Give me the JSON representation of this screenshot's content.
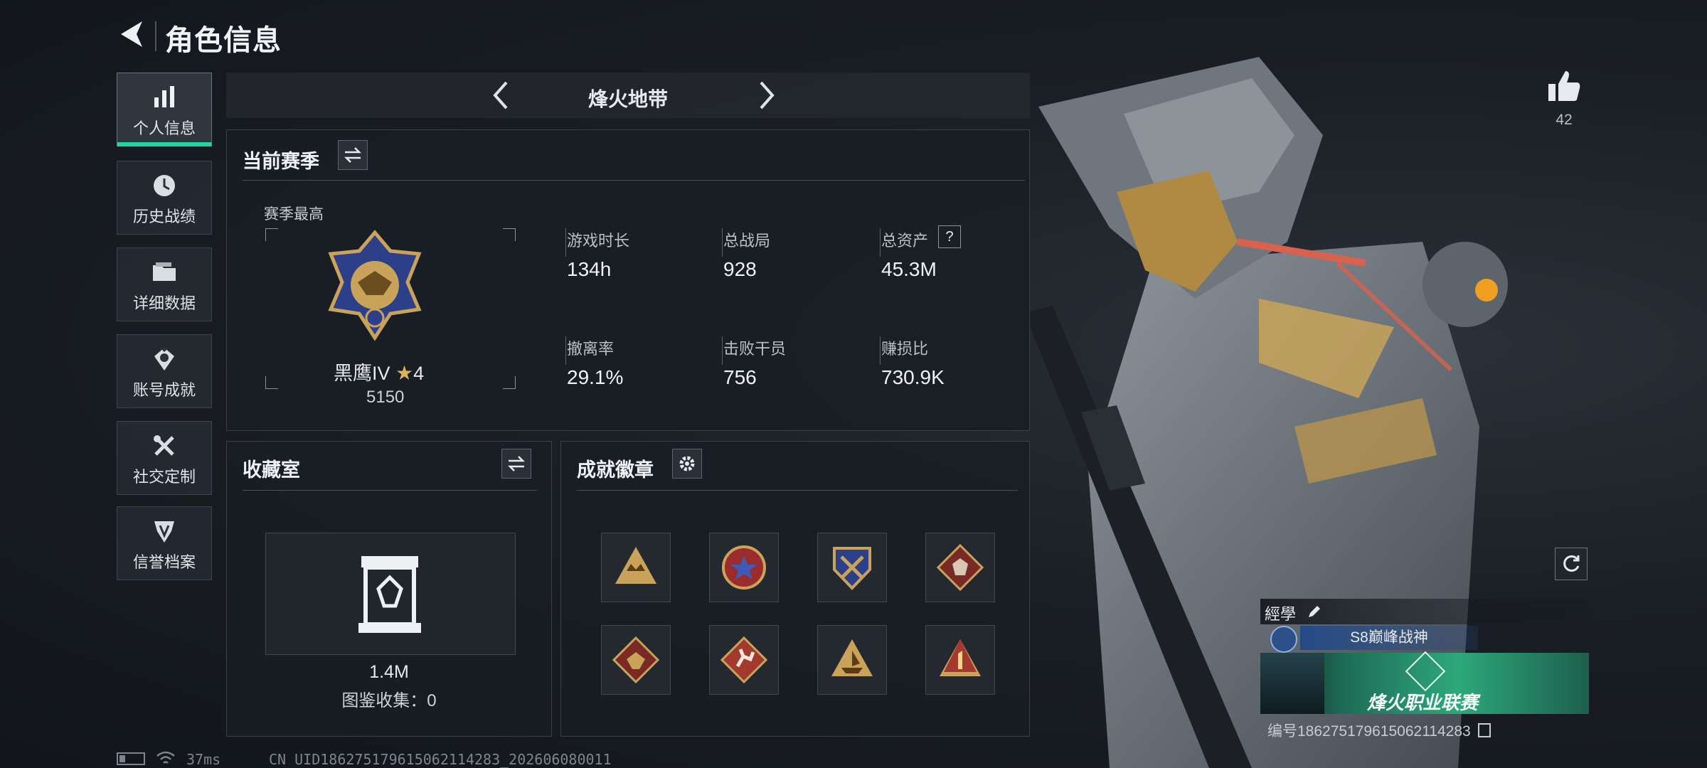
{
  "header": {
    "title": "角色信息"
  },
  "sidebar": {
    "items": [
      {
        "label": "个人信息",
        "icon": "bar-chart-icon",
        "active": true
      },
      {
        "label": "历史战绩",
        "icon": "clock-icon"
      },
      {
        "label": "详细数据",
        "icon": "folder-icon"
      },
      {
        "label": "账号成就",
        "icon": "medal-icon"
      },
      {
        "label": "社交定制",
        "icon": "tools-icon"
      },
      {
        "label": "信誉档案",
        "icon": "shield-badge-icon"
      }
    ]
  },
  "mode": {
    "label": "烽火地带"
  },
  "season": {
    "title": "当前赛季",
    "best_label": "赛季最高",
    "rank_name": "黑鹰IV",
    "rank_stars": "4",
    "rank_score": "5150",
    "stats": [
      {
        "label": "游戏时长",
        "value": "134h"
      },
      {
        "label": "总战局",
        "value": "928"
      },
      {
        "label": "总资产",
        "value": "45.3M",
        "has_help": true
      },
      {
        "label": "撤离率",
        "value": "29.1%"
      },
      {
        "label": "击败干员",
        "value": "756"
      },
      {
        "label": "赚损比",
        "value": "730.9K"
      }
    ],
    "help_glyph": "?"
  },
  "collection": {
    "title": "收藏室",
    "value": "1.4M",
    "catalog_label": "图鉴收集：0"
  },
  "achievements": {
    "title": "成就徽章",
    "badges": [
      "crown-badge",
      "star-wreath-badge",
      "crossed-swords-badge",
      "dragon-badge",
      "dragon-red-badge",
      "runner-badge",
      "ship-badge",
      "rank-one-badge"
    ]
  },
  "likes": {
    "count": "42"
  },
  "player": {
    "name": "經學",
    "title_badge": "S8巅峰战神",
    "banner_text": "烽火职业联赛",
    "id_label": "编号1862751796150621142​83"
  },
  "status_bar": {
    "ping": "37ms",
    "uid": "CN UID1862751796150621142​83_202606080011"
  },
  "colors": {
    "accent": "#1fd6a2",
    "gold": "#c9a35a",
    "panel_bg": "#191e24"
  }
}
